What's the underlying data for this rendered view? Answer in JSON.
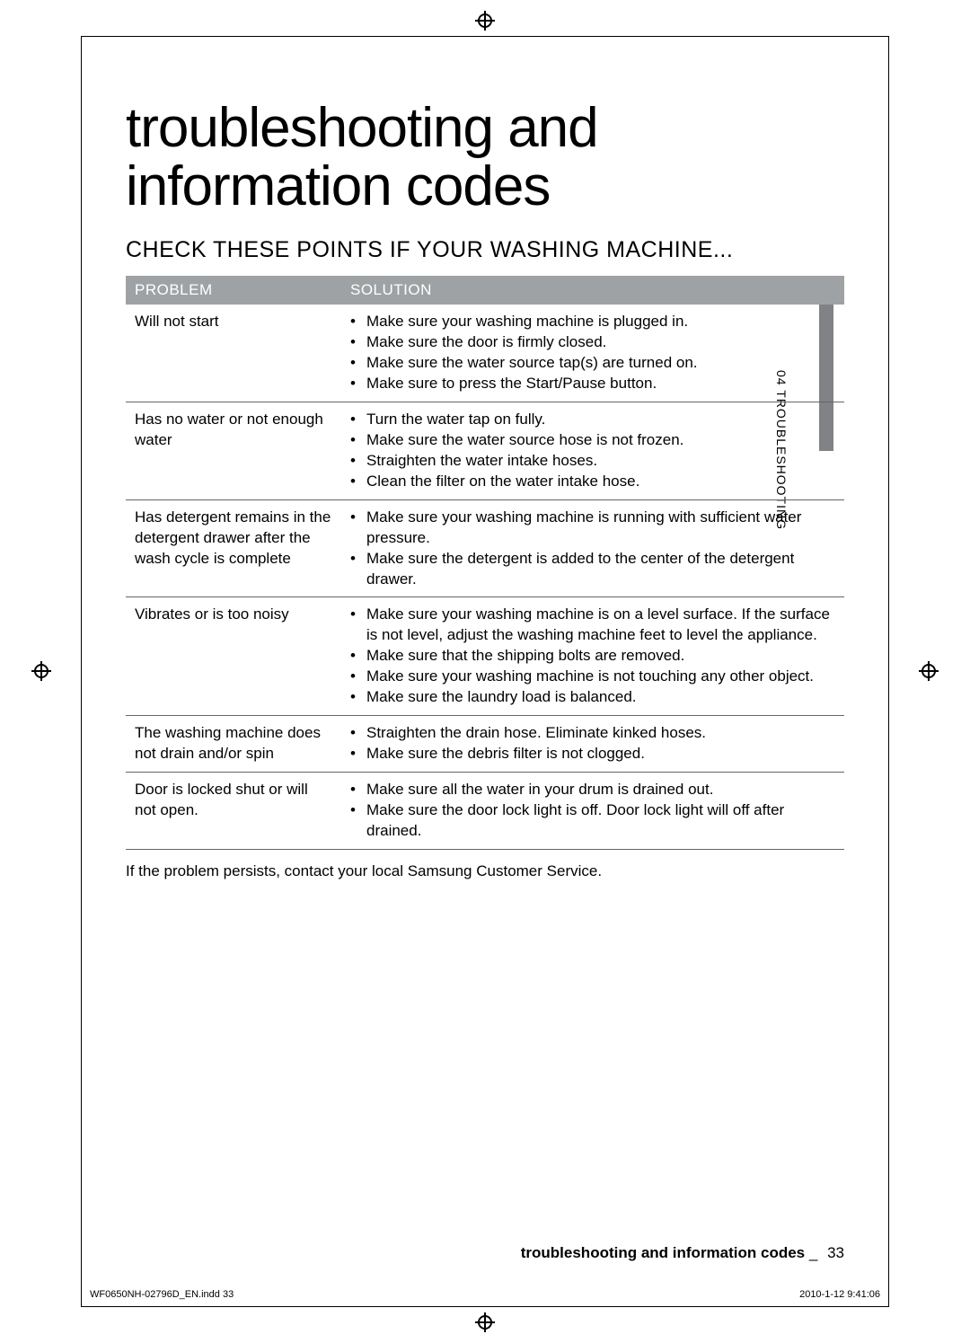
{
  "title": "troubleshooting and information codes",
  "section_head": "CHECK THESE POINTS IF YOUR WASHING MACHINE...",
  "side_tab": "04  TROUBLESHOOTING",
  "table": {
    "headers": {
      "problem": "PROBLEM",
      "solution": "SOLUTION"
    },
    "rows": [
      {
        "problem": "Will not start",
        "solutions": [
          "Make sure your washing machine is plugged in.",
          "Make sure the door is firmly closed.",
          "Make sure the water source tap(s) are turned on.",
          "Make sure to press the Start/Pause button."
        ]
      },
      {
        "problem": "Has no water or not enough water",
        "solutions": [
          "Turn the water tap on fully.",
          "Make sure the water source hose is not frozen.",
          "Straighten the water intake hoses.",
          "Clean the filter on the water intake hose."
        ]
      },
      {
        "problem": "Has detergent remains in the detergent drawer after the wash cycle is complete",
        "solutions": [
          "Make sure your washing machine is running with sufficient water pressure.",
          "Make sure the detergent is added to the center of the detergent drawer."
        ]
      },
      {
        "problem": "Vibrates or is too noisy",
        "solutions": [
          "Make sure your washing machine is on a level surface. If the surface is not level, adjust the washing machine feet to level the appliance.",
          "Make sure that the shipping bolts are removed.",
          "Make sure your washing machine is not touching any other object.",
          "Make sure the laundry load is balanced."
        ]
      },
      {
        "problem": "The washing machine does not drain and/or spin",
        "solutions": [
          "Straighten the drain hose. Eliminate kinked hoses.",
          "Make sure the debris filter is not clogged."
        ]
      },
      {
        "problem": "Door is locked shut or will not open.",
        "solutions": [
          "Make sure all the water in your drum is drained out.",
          "Make sure the door lock light is off. Door lock light will off after drained."
        ]
      }
    ]
  },
  "note": "If the problem persists, contact your local Samsung Customer Service.",
  "footer": {
    "title": "troubleshooting and information codes",
    "sep": "_",
    "page": "33"
  },
  "slug": {
    "file": "WF0650NH-02796D_EN.indd   33",
    "date": "2010-1-12   9:41:06"
  }
}
